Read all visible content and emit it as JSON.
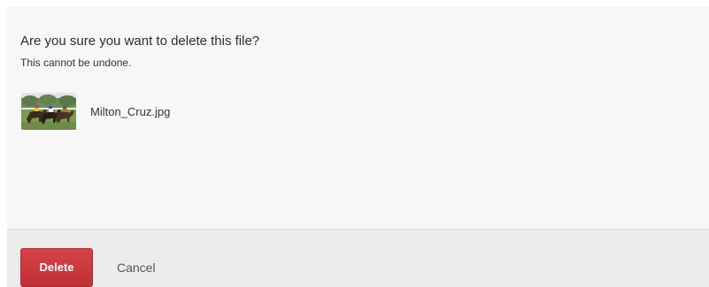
{
  "dialog": {
    "title": "Are you sure you want to delete this file?",
    "subtitle": "This cannot be undone.",
    "file": {
      "name": "Milton_Cruz.jpg",
      "thumbnail_icon": "image-thumbnail-icon"
    },
    "actions": {
      "delete_label": "Delete",
      "cancel_label": "Cancel"
    }
  },
  "colors": {
    "dialog_background": "#f7f7f7",
    "footer_background": "#ececec",
    "delete_button": "#c9363d",
    "delete_text": "#ffffff",
    "cancel_text": "#555555"
  }
}
